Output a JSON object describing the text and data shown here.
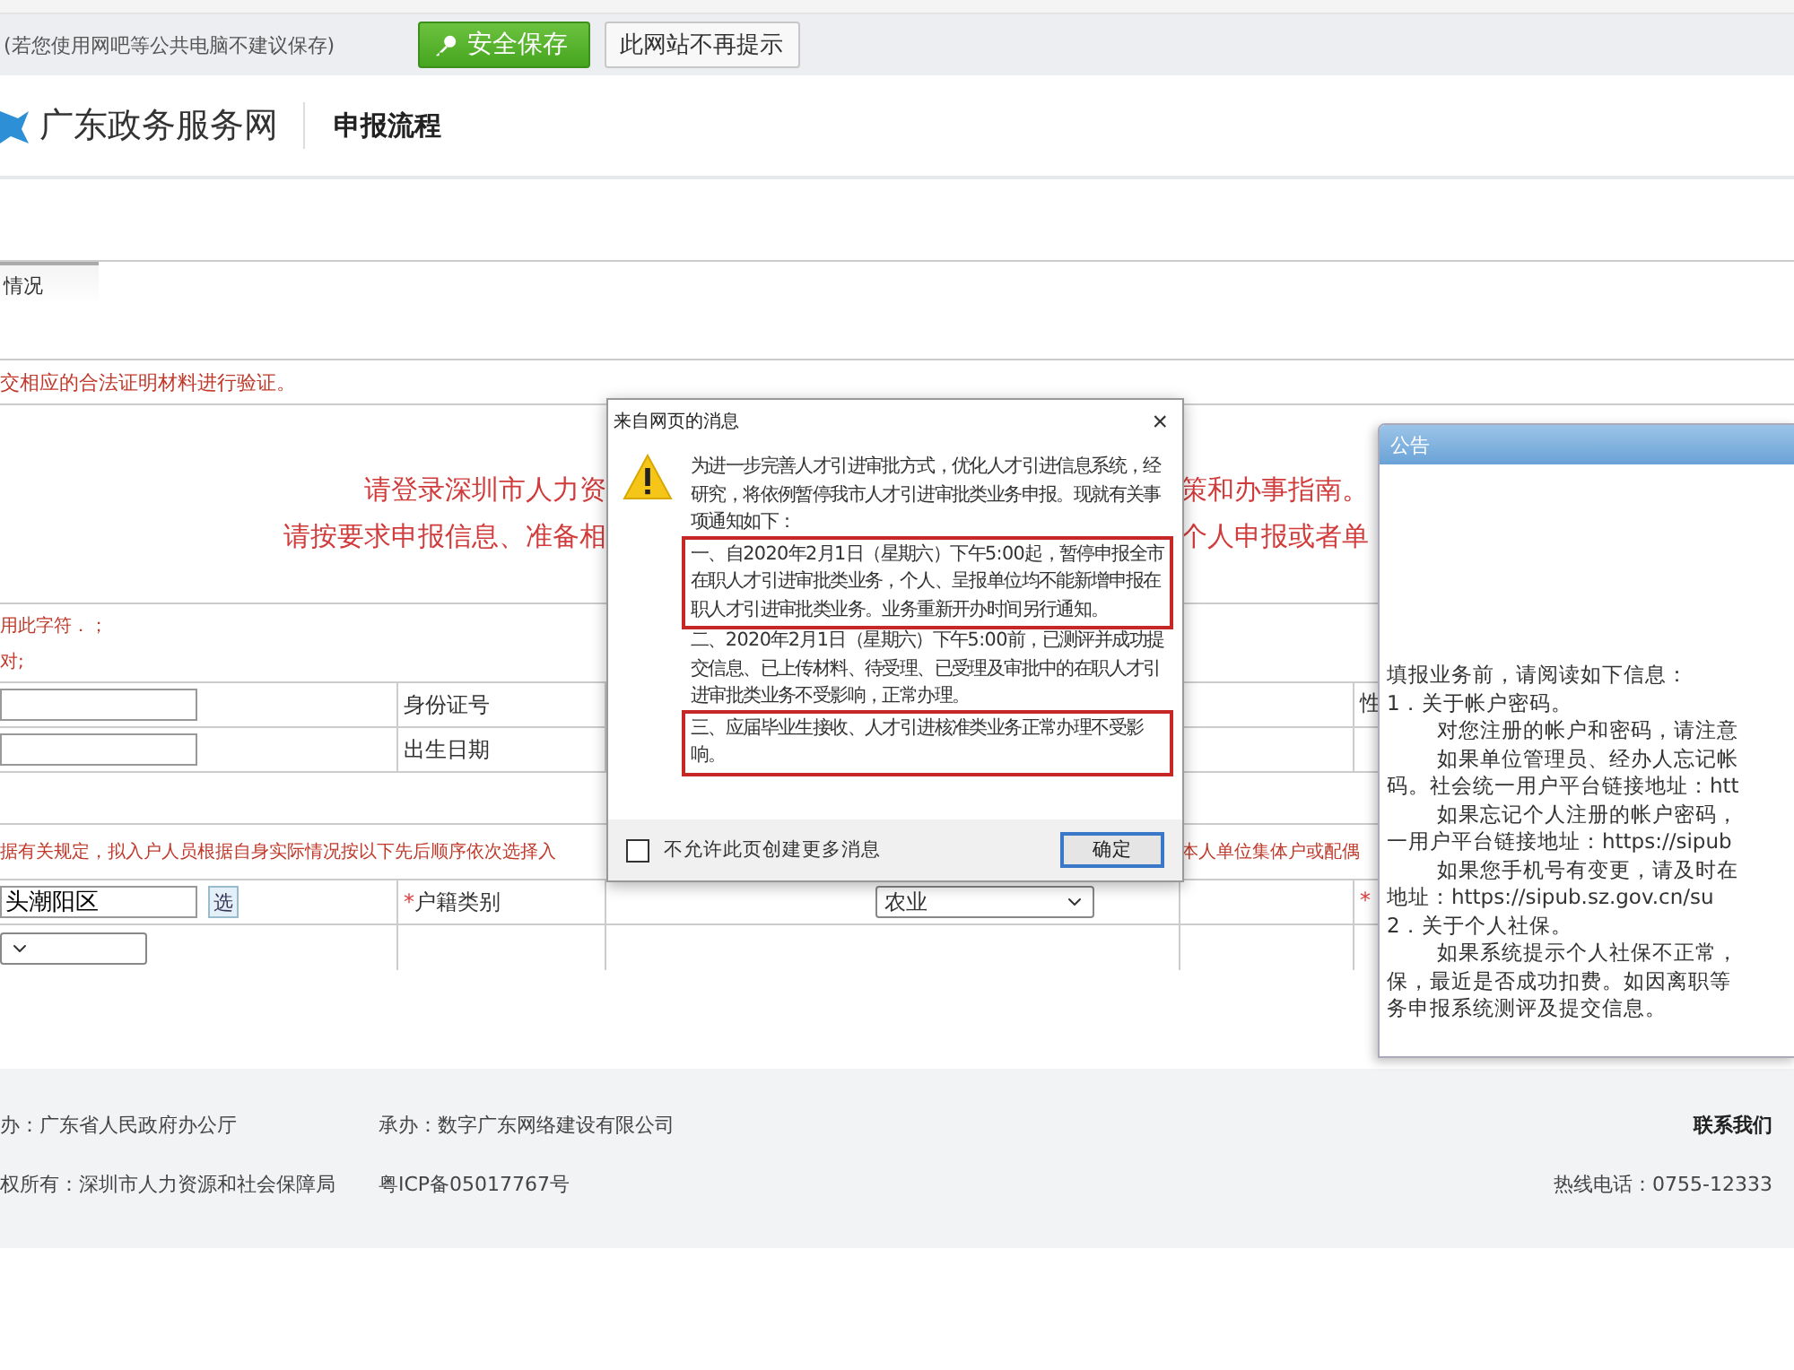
{
  "save_bar": {
    "notice": "(若您使用网吧等公共电脑不建议保存)",
    "buttons": [
      {
        "label": "安全保存",
        "kind": "primary"
      },
      {
        "label": "此网站不再提示",
        "kind": "plain"
      }
    ]
  },
  "header": {
    "site_name": "广东政务服务网",
    "section": "申报流程"
  },
  "tabs": [
    {
      "label": "情况",
      "selected": true
    }
  ],
  "notice": "交相应的合法证明材料进行验证。",
  "banner": [
    {
      "left": "请登录深圳市人力资",
      "right": "策和办事指南。"
    },
    {
      "left": "请按要求申报信息、准备相",
      "right": "个人申报或者单"
    }
  ],
  "form_rows": [
    {
      "kind": "hint",
      "lines": [
        "用此字符．；",
        "对;"
      ]
    },
    {
      "kind": "field",
      "label": "身份证号",
      "label_right": "性"
    },
    {
      "kind": "field",
      "label": "出生日期"
    },
    {
      "kind": "blank"
    },
    {
      "kind": "split_hint",
      "left": "据有关规定，拟入户人员根据自身实际情况按以下先后顺序依次选择入",
      "right": "本人单位集体户或配偶"
    },
    {
      "kind": "field",
      "value": "头潮阳区",
      "button": "选",
      "mark": "*",
      "label": "户籍类别",
      "select": "农业",
      "label_right_mark": "*"
    },
    {
      "kind": "select"
    }
  ],
  "footer": {
    "left": [
      "办：广东省人民政府办公厅",
      "承办：数字广东网络建设有限公司",
      "权所有：深圳市人力资源和社会保障局",
      "粤ICP备05017767号"
    ],
    "contact": "联系我们",
    "hotline": "热线电话：0755-12333"
  },
  "dialog": {
    "title": "来自网页的消息",
    "close": "×",
    "paragraphs": [
      {
        "text": "为进一步完善人才引进审批方式，优化人才引进信息系统，经研究，将依例暂停我市人才引进审批类业务申报。现就有关事项通知如下：",
        "highlighted": false
      },
      {
        "text": "一、自2020年2月1日（星期六）下午5:00起，暂停申报全市在职人才引进审批类业务，个人、呈报单位均不能新增申报在职人才引进审批类业务。业务重新开办时间另行通知。",
        "highlighted": true
      },
      {
        "text": "二、2020年2月1日（星期六）下午5:00前，已测评并成功提交信息、已上传材料、待受理、已受理及审批中的在职人才引进审批类业务不受影响，正常办理。",
        "highlighted": false
      },
      {
        "text": "三、应届毕业生接收、人才引进核准类业务正常办理不受影响。",
        "highlighted": true
      }
    ],
    "checkbox": {
      "label": "不允许此页创建更多消息",
      "checked": false
    },
    "ok_button": "确定"
  },
  "announcement": {
    "title": "公告",
    "lines": [
      {
        "text": "填报业务前，请阅读如下信息：",
        "indent": false
      },
      {
        "text": "1．关于帐户密码。",
        "indent": false
      },
      {
        "text": "对您注册的帐户和密码，请注意",
        "indent": true
      },
      {
        "text": "如果单位管理员、经办人忘记帐",
        "indent": true
      },
      {
        "text": "码。社会统一用户平台链接地址：htt",
        "indent": false
      },
      {
        "text": "如果忘记个人注册的帐户密码，",
        "indent": true
      },
      {
        "text": "一用户平台链接地址：https://sipub",
        "indent": false
      },
      {
        "text": "如果您手机号有变更，请及时在",
        "indent": true
      },
      {
        "text": "地址：https://sipub.sz.gov.cn/su",
        "indent": false
      },
      {
        "text": "2．关于个人社保。",
        "indent": false
      },
      {
        "text": "如果系统提示个人社保不正常，",
        "indent": true
      },
      {
        "text": "保，最近是否成功扣费。如因离职等",
        "indent": false
      },
      {
        "text": "务申报系统测评及提交信息。",
        "indent": false
      }
    ]
  }
}
